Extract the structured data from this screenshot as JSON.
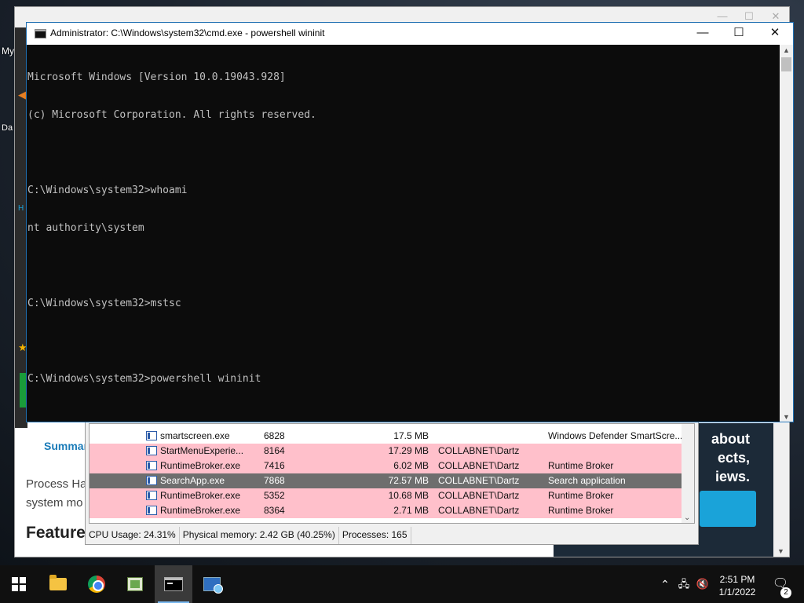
{
  "desktop": {
    "labels": [
      "My",
      "Da"
    ]
  },
  "browser": {
    "summary_link": "Summar",
    "body_lines": [
      "Process Ha",
      "system mo"
    ],
    "features_heading": "Features",
    "ad_text": [
      "about",
      "ects,",
      "iews."
    ]
  },
  "process_hacker": {
    "rows": [
      {
        "name": "smartscreen.exe",
        "pid": "6828",
        "memory": "17.5 MB",
        "user": "",
        "description": "Windows Defender SmartScre...",
        "style": "normal"
      },
      {
        "name": "StartMenuExperie...",
        "pid": "8164",
        "memory": "17.29 MB",
        "user": "COLLABNET\\Dartz",
        "description": "",
        "style": "pink"
      },
      {
        "name": "RuntimeBroker.exe",
        "pid": "7416",
        "memory": "6.02 MB",
        "user": "COLLABNET\\Dartz",
        "description": "Runtime Broker",
        "style": "pink"
      },
      {
        "name": "SearchApp.exe",
        "pid": "7868",
        "memory": "72.57 MB",
        "user": "COLLABNET\\Dartz",
        "description": "Search application",
        "style": "selected"
      },
      {
        "name": "RuntimeBroker.exe",
        "pid": "5352",
        "memory": "10.68 MB",
        "user": "COLLABNET\\Dartz",
        "description": "Runtime Broker",
        "style": "pink"
      },
      {
        "name": "RuntimeBroker.exe",
        "pid": "8364",
        "memory": "2.71 MB",
        "user": "COLLABNET\\Dartz",
        "description": "Runtime Broker",
        "style": "pink"
      }
    ],
    "status": {
      "cpu": "CPU Usage: 24.31%",
      "memory": "Physical memory: 2.42 GB (40.25%)",
      "processes": "Processes: 165"
    }
  },
  "cmd": {
    "title": "Administrator: C:\\Windows\\system32\\cmd.exe - powershell  wininit",
    "lines": [
      "Microsoft Windows [Version 10.0.19043.928]",
      "(c) Microsoft Corporation. All rights reserved.",
      "",
      "C:\\Windows\\system32>whoami",
      "nt authority\\system",
      "",
      "C:\\Windows\\system32>mstsc",
      "",
      "C:\\Windows\\system32>powershell wininit"
    ],
    "minimize": "—",
    "maximize": "☐",
    "close": "✕"
  },
  "taskbar": {
    "apps": [
      {
        "name": "file-explorer",
        "icon": "folder-icon"
      },
      {
        "name": "google-chrome",
        "icon": "chrome-icon"
      },
      {
        "name": "process-hacker",
        "icon": "process-hacker-icon"
      },
      {
        "name": "command-prompt",
        "icon": "terminal-icon",
        "active": true
      },
      {
        "name": "remote-desktop",
        "icon": "remote-desktop-icon"
      }
    ],
    "time": "2:51 PM",
    "date": "1/1/2022",
    "notification_count": "2"
  },
  "colors": {
    "cmd_background": "#0c0c0c",
    "cmd_text": "#c0c0c0",
    "process_pink": "#ffc0cb",
    "process_selected": "#6e6e6e",
    "taskbar": "#101010"
  }
}
